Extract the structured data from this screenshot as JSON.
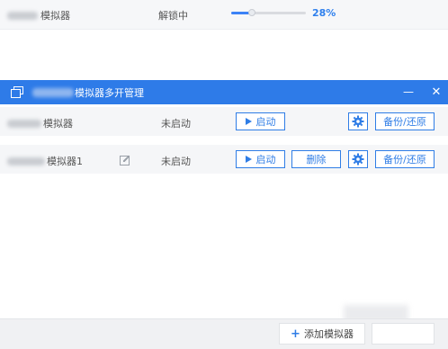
{
  "background_row": {
    "name_suffix": "模拟器",
    "status": "解锁中",
    "progress_fraction": 0.28,
    "progress_text": "28%"
  },
  "dialog": {
    "title_suffix": "模拟器多开管理",
    "minimize_glyph": "—",
    "close_glyph": "✕",
    "rows": [
      {
        "name_suffix": "模拟器",
        "status": "未启动",
        "start_label": "启动",
        "backup_label": "备份/还原",
        "gear_icon": "gear-icon"
      },
      {
        "name_suffix": "模拟器1",
        "status": "未启动",
        "start_label": "启动",
        "delete_label": "删除",
        "backup_label": "备份/还原",
        "edit_icon": "edit-icon",
        "gear_icon": "gear-icon"
      }
    ],
    "add_button_label": "添加模拟器"
  },
  "colors": {
    "accent": "#2e7be8",
    "progress": "#3b82f6",
    "percent_text": "#2f80ed"
  }
}
